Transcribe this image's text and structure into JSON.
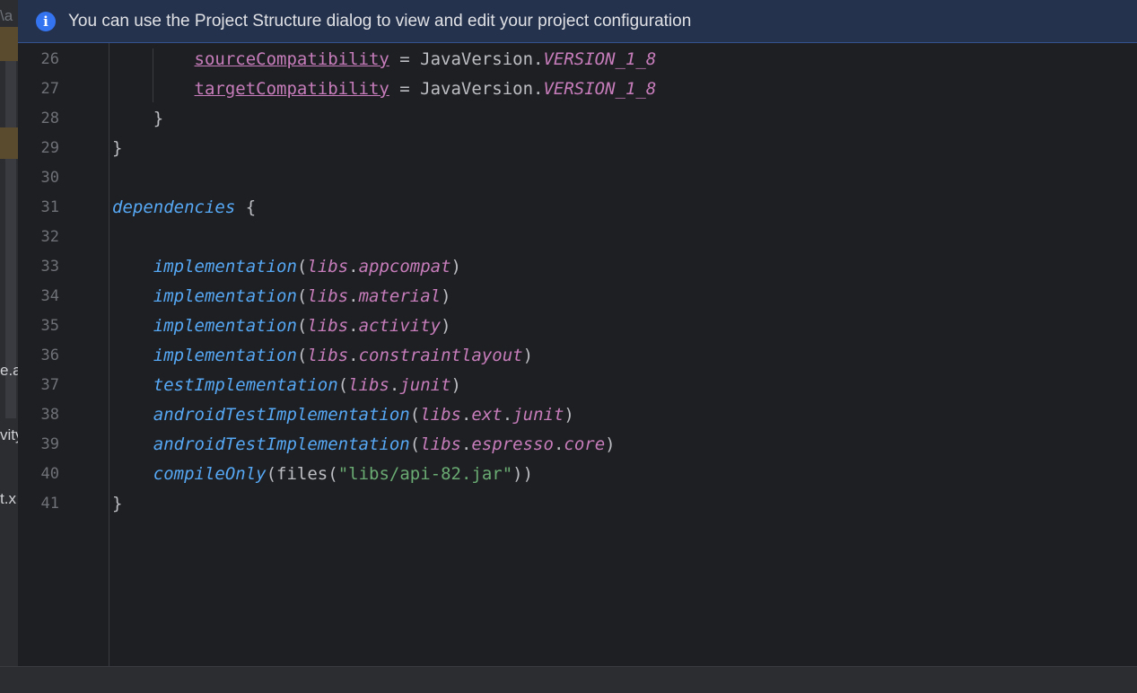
{
  "banner": {
    "icon": "info-icon",
    "message": "You can use the Project Structure dialog to view and edit your project configuration"
  },
  "left_panel": {
    "fragments": [
      "\\a",
      "e.a",
      "vity",
      "t.x"
    ]
  },
  "colors": {
    "editor_bg": "#1e1f22",
    "banner_bg": "#25324d",
    "function": "#56a8f5",
    "property": "#c77dbb",
    "string": "#6aab73",
    "text": "#bcbec4",
    "line_number": "#6e7177"
  },
  "editor": {
    "lines": [
      {
        "num": "26",
        "indent": "        ",
        "tokens": [
          {
            "t": "sourceCompatibility",
            "c": "prop-u"
          },
          {
            "t": " = JavaVersion.",
            "c": "plain"
          },
          {
            "t": "VERSION_1_8",
            "c": "prop"
          }
        ]
      },
      {
        "num": "27",
        "indent": "        ",
        "tokens": [
          {
            "t": "targetCompatibility",
            "c": "prop-u"
          },
          {
            "t": " = JavaVersion.",
            "c": "plain"
          },
          {
            "t": "VERSION_1_8",
            "c": "prop"
          }
        ]
      },
      {
        "num": "28",
        "indent": "    ",
        "tokens": [
          {
            "t": "}",
            "c": "plain"
          }
        ]
      },
      {
        "num": "29",
        "indent": "",
        "tokens": [
          {
            "t": "}",
            "c": "plain"
          }
        ]
      },
      {
        "num": "30",
        "indent": "",
        "tokens": []
      },
      {
        "num": "31",
        "indent": "",
        "tokens": [
          {
            "t": "dependencies",
            "c": "kw-fn"
          },
          {
            "t": " {",
            "c": "plain"
          }
        ]
      },
      {
        "num": "32",
        "indent": "",
        "tokens": []
      },
      {
        "num": "33",
        "indent": "    ",
        "tokens": [
          {
            "t": "implementation",
            "c": "kw-fn"
          },
          {
            "t": "(",
            "c": "plain"
          },
          {
            "t": "libs",
            "c": "prop"
          },
          {
            "t": ".",
            "c": "plain"
          },
          {
            "t": "appcompat",
            "c": "prop"
          },
          {
            "t": ")",
            "c": "plain"
          }
        ]
      },
      {
        "num": "34",
        "indent": "    ",
        "tokens": [
          {
            "t": "implementation",
            "c": "kw-fn"
          },
          {
            "t": "(",
            "c": "plain"
          },
          {
            "t": "libs",
            "c": "prop"
          },
          {
            "t": ".",
            "c": "plain"
          },
          {
            "t": "material",
            "c": "prop"
          },
          {
            "t": ")",
            "c": "plain"
          }
        ]
      },
      {
        "num": "35",
        "indent": "    ",
        "tokens": [
          {
            "t": "implementation",
            "c": "kw-fn"
          },
          {
            "t": "(",
            "c": "plain"
          },
          {
            "t": "libs",
            "c": "prop"
          },
          {
            "t": ".",
            "c": "plain"
          },
          {
            "t": "activity",
            "c": "prop"
          },
          {
            "t": ")",
            "c": "plain"
          }
        ]
      },
      {
        "num": "36",
        "indent": "    ",
        "tokens": [
          {
            "t": "implementation",
            "c": "kw-fn"
          },
          {
            "t": "(",
            "c": "plain"
          },
          {
            "t": "libs",
            "c": "prop"
          },
          {
            "t": ".",
            "c": "plain"
          },
          {
            "t": "constraintlayout",
            "c": "prop"
          },
          {
            "t": ")",
            "c": "plain"
          }
        ]
      },
      {
        "num": "37",
        "indent": "    ",
        "tokens": [
          {
            "t": "testImplementation",
            "c": "kw-fn"
          },
          {
            "t": "(",
            "c": "plain"
          },
          {
            "t": "libs",
            "c": "prop"
          },
          {
            "t": ".",
            "c": "plain"
          },
          {
            "t": "junit",
            "c": "prop"
          },
          {
            "t": ")",
            "c": "plain"
          }
        ]
      },
      {
        "num": "38",
        "indent": "    ",
        "tokens": [
          {
            "t": "androidTestImplementation",
            "c": "kw-fn"
          },
          {
            "t": "(",
            "c": "plain"
          },
          {
            "t": "libs",
            "c": "prop"
          },
          {
            "t": ".",
            "c": "plain"
          },
          {
            "t": "ext",
            "c": "prop"
          },
          {
            "t": ".",
            "c": "plain"
          },
          {
            "t": "junit",
            "c": "prop"
          },
          {
            "t": ")",
            "c": "plain"
          }
        ]
      },
      {
        "num": "39",
        "indent": "    ",
        "tokens": [
          {
            "t": "androidTestImplementation",
            "c": "kw-fn"
          },
          {
            "t": "(",
            "c": "plain"
          },
          {
            "t": "libs",
            "c": "prop"
          },
          {
            "t": ".",
            "c": "plain"
          },
          {
            "t": "espresso",
            "c": "prop"
          },
          {
            "t": ".",
            "c": "plain"
          },
          {
            "t": "core",
            "c": "prop"
          },
          {
            "t": ")",
            "c": "plain"
          }
        ]
      },
      {
        "num": "40",
        "indent": "    ",
        "tokens": [
          {
            "t": "compileOnly",
            "c": "kw-fn"
          },
          {
            "t": "(files(",
            "c": "plain"
          },
          {
            "t": "\"libs/api-82.jar\"",
            "c": "str"
          },
          {
            "t": "))",
            "c": "plain"
          }
        ]
      },
      {
        "num": "41",
        "indent": "",
        "tokens": [
          {
            "t": "}",
            "c": "plain"
          }
        ]
      }
    ]
  }
}
